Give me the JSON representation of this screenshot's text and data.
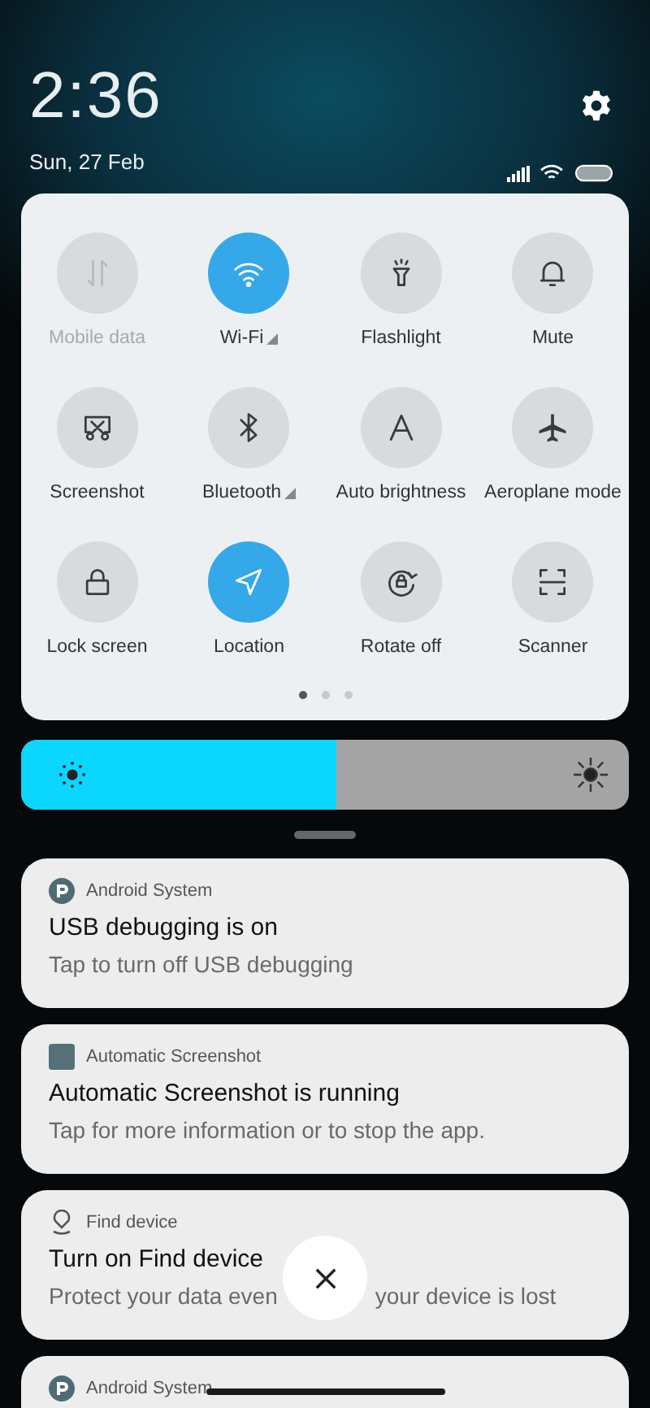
{
  "header": {
    "time": "2:36",
    "date": "Sun, 27 Feb"
  },
  "tiles": [
    {
      "label": "Mobile data",
      "selected": false,
      "disabled": true,
      "has_menu": false
    },
    {
      "label": "Wi-Fi",
      "selected": true,
      "disabled": false,
      "has_menu": true
    },
    {
      "label": "Flashlight",
      "selected": false,
      "disabled": false,
      "has_menu": false
    },
    {
      "label": "Mute",
      "selected": false,
      "disabled": false,
      "has_menu": false
    },
    {
      "label": "Screenshot",
      "selected": false,
      "disabled": false,
      "has_menu": false
    },
    {
      "label": "Bluetooth",
      "selected": false,
      "disabled": false,
      "has_menu": true
    },
    {
      "label": "Auto brightness",
      "selected": false,
      "disabled": false,
      "has_menu": false
    },
    {
      "label": "Aeroplane mode",
      "selected": false,
      "disabled": false,
      "has_menu": false
    },
    {
      "label": "Lock screen",
      "selected": false,
      "disabled": false,
      "has_menu": false
    },
    {
      "label": "Location",
      "selected": true,
      "disabled": false,
      "has_menu": false
    },
    {
      "label": "Rotate off",
      "selected": false,
      "disabled": false,
      "has_menu": false
    },
    {
      "label": "Scanner",
      "selected": false,
      "disabled": false,
      "has_menu": false
    }
  ],
  "pages": [
    {
      "selected": true
    },
    {
      "selected": false
    },
    {
      "selected": false
    }
  ],
  "brightness": {
    "level": 0.52
  },
  "notifications": [
    {
      "app": "Android System",
      "kind": "system",
      "title": "USB debugging is on",
      "body": [
        "Tap to turn off USB debugging"
      ]
    },
    {
      "app": "Automatic Screenshot",
      "kind": "app",
      "title": "Automatic Screenshot is running",
      "body": [
        "Tap for more information or to stop the app."
      ]
    },
    {
      "app": "Find device",
      "kind": "location",
      "title": "Turn on Find device",
      "body": [
        "Protect your data even",
        "your device is lost"
      ]
    },
    {
      "app": "Android System",
      "kind": "system"
    }
  ]
}
